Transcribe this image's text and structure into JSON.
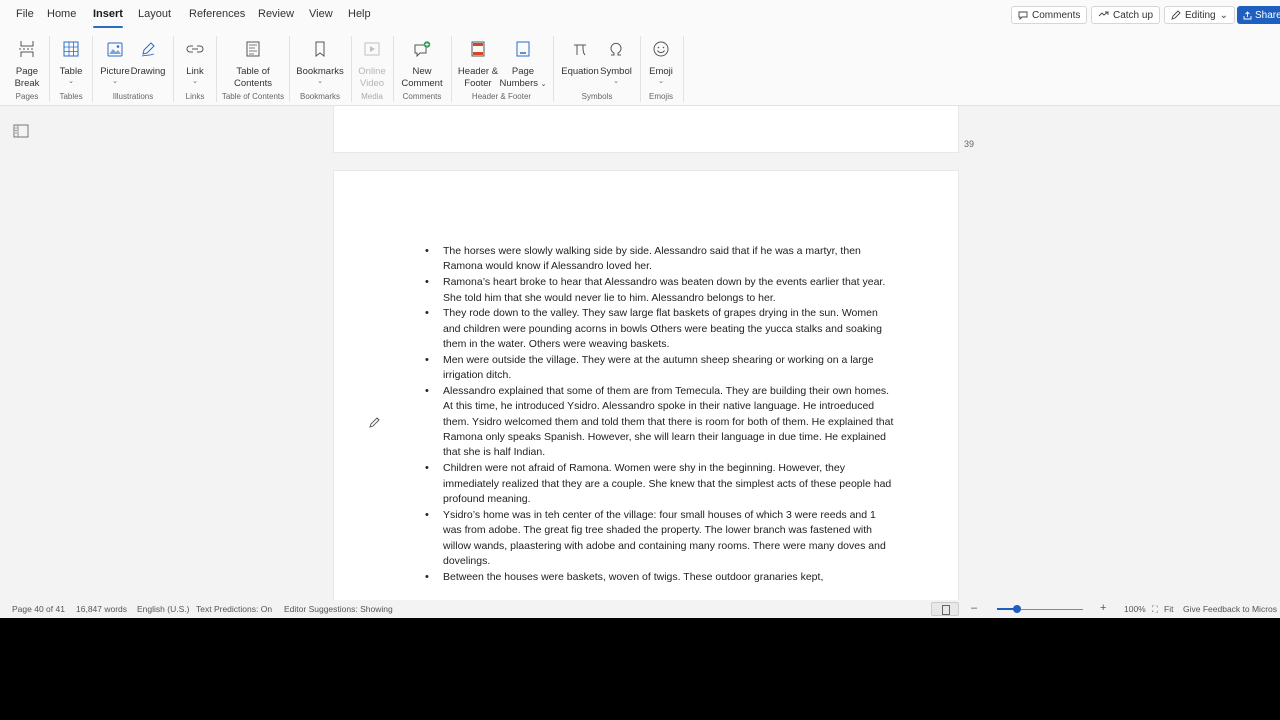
{
  "menu": {
    "tabs": [
      "File",
      "Home",
      "Insert",
      "Layout",
      "References",
      "Review",
      "View",
      "Help"
    ],
    "active": "Insert",
    "comments_label": "Comments",
    "catchup_label": "Catch up",
    "editing_label": "Editing",
    "share_label": "Share"
  },
  "ribbon": {
    "page_break": [
      "Page",
      "Break"
    ],
    "table": "Table",
    "picture": "Picture",
    "drawing": "Drawing",
    "link": "Link",
    "toc": [
      "Table of",
      "Contents"
    ],
    "bookmarks": "Bookmarks",
    "online_video": [
      "Online",
      "Video"
    ],
    "new_comment": [
      "New",
      "Comment"
    ],
    "header_footer": [
      "Header &",
      "Footer"
    ],
    "page_numbers": [
      "Page",
      "Numbers"
    ],
    "equation": "Equation",
    "symbol": "Symbol",
    "emoji": "Emoji",
    "groups": {
      "pages": "Pages",
      "tables": "Tables",
      "illustrations": "Illustrations",
      "links": "Links",
      "toc": "Table of Contents",
      "bookmarks": "Bookmarks",
      "media": "Media",
      "comments": "Comments",
      "header_footer": "Header & Footer",
      "symbols": "Symbols",
      "emojis": "Emojis"
    }
  },
  "document": {
    "prev_page_number": "39",
    "bullets": [
      "The horses were slowly walking side by side. Alessandro said that if he was a martyr, then Ramona would know if Alessandro loved her.",
      "Ramona’s heart broke to hear that Alessandro was beaten down by the events earlier that year. She told him that she would never lie to him. Alessandro belongs to her.",
      "They rode down to the valley. They saw large flat baskets of grapes drying in the sun. Women and children were pounding acorns in bowls Others were beating the yucca stalks and soaking them in the water. Others were weaving baskets.",
      "Men were outside the village. They were at the autumn sheep shearing or working on a large irrigation ditch.",
      "Alessandro explained that some of them are from Temecula. They are building their own homes. At this time, he introduced Ysidro. Alessandro spoke in their native language. He introeduced them. Ysidro welcomed them and told them that there is room for both of them. He explained that Ramona only speaks Spanish. However, she will learn their language in due time. He explained that she is half Indian.",
      "Children were not afraid of Ramona. Women were shy in the beginning. However, they immediately realized that they are a couple. She knew that the simplest acts of these people had profound meaning.",
      "Ysidro’s home was in teh center of the village: four small houses of which 3 were reeds and 1 was from adobe. The great fig tree shaded the property. The lower branch was fastened with willow wands, plaastering with adobe and containing many rooms. There were many doves and dovelings.",
      "Between the houses were baskets, woven of twigs. These outdoor granaries kept,"
    ]
  },
  "status": {
    "page": "Page 40 of 41",
    "words": "16,847 words",
    "language": "English (U.S.)",
    "text_predictions": "Text Predictions: On",
    "editor": "Editor Suggestions: Showing",
    "zoom": "100%",
    "fit": "Fit",
    "feedback": "Give Feedback to Micros"
  }
}
